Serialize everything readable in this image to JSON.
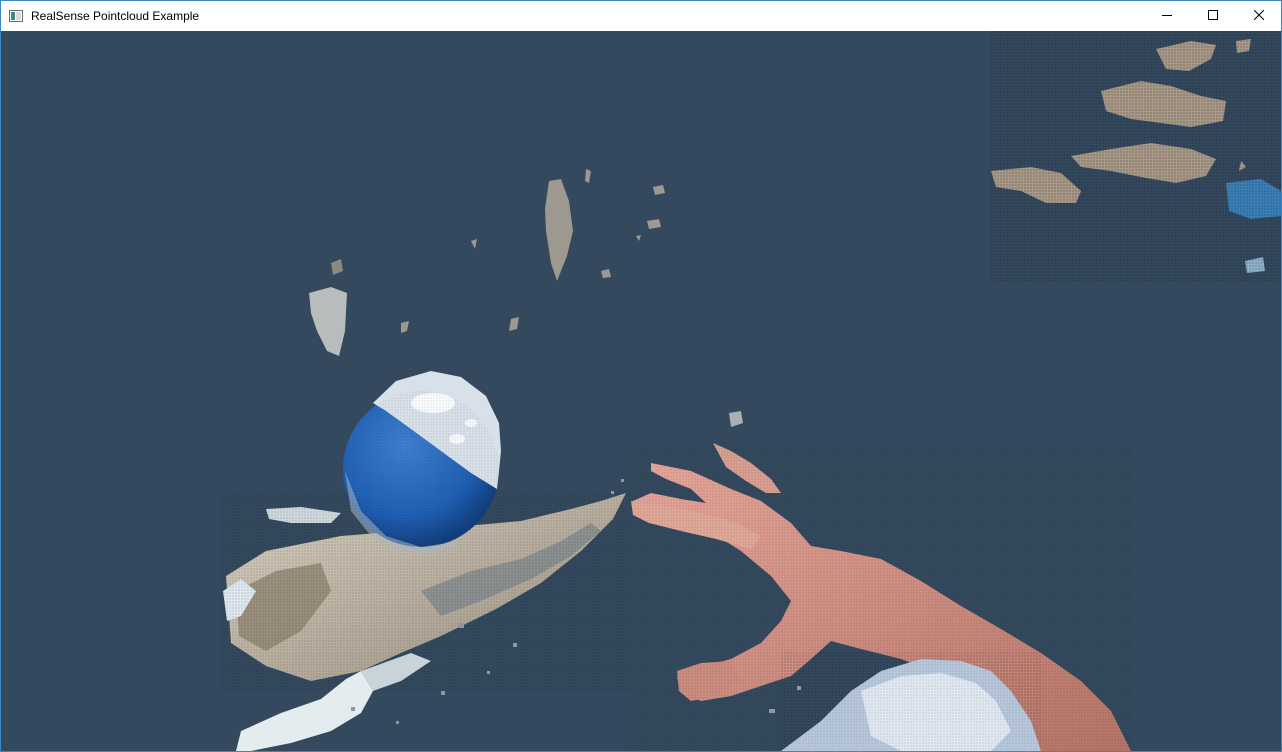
{
  "window": {
    "title": "RealSense Pointcloud Example",
    "app_icon": "window-app-icon",
    "controls": {
      "minimize_icon": "minimize-icon",
      "maximize_icon": "maximize-icon",
      "close_icon": "close-icon"
    }
  },
  "viewport": {
    "content": "3d-pointcloud-render",
    "background_color": "#34495e",
    "colors": {
      "ball_blue": "#1f5fb4",
      "ball_white": "#cfd8e6",
      "skin": "#d9958a",
      "box": "#c9c0b0",
      "wall": "#a89888",
      "cloth": "#dfe8f0"
    }
  }
}
